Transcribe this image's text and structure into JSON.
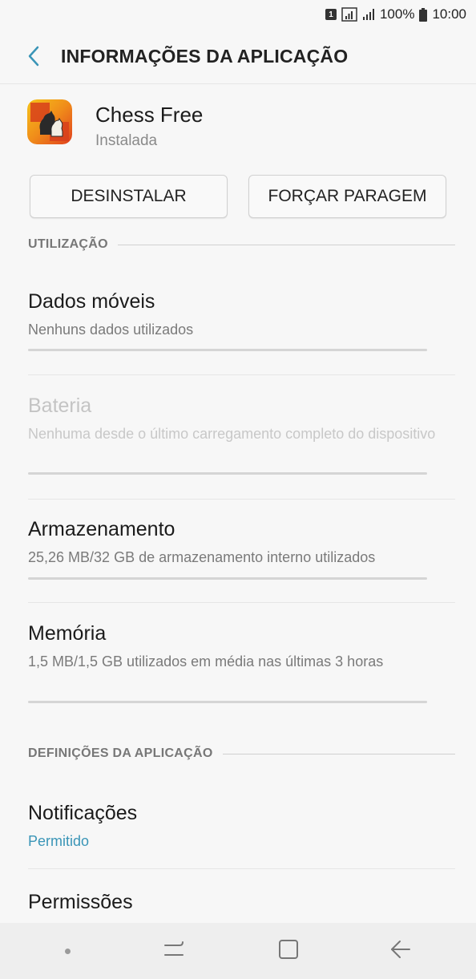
{
  "status_bar": {
    "sim_label": "1",
    "battery_percent": "100%",
    "time": "10:00"
  },
  "app_bar": {
    "title": "INFORMAÇÕES DA APLICAÇÃO"
  },
  "app": {
    "name": "Chess Free",
    "status": "Instalada"
  },
  "buttons": {
    "uninstall": "DESINSTALAR",
    "force_stop": "FORÇAR PARAGEM"
  },
  "sections": {
    "usage": "UTILIZAÇÃO",
    "app_settings": "DEFINIÇÕES DA APLICAÇÃO"
  },
  "items": {
    "mobile_data": {
      "title": "Dados móveis",
      "subtitle": "Nenhuns dados utilizados"
    },
    "battery": {
      "title": "Bateria",
      "subtitle": "Nenhuma desde o último carregamento completo do dispositivo"
    },
    "storage": {
      "title": "Armazenamento",
      "subtitle": "25,26 MB/32 GB de armazenamento interno utilizados"
    },
    "memory": {
      "title": "Memória",
      "subtitle": "1,5 MB/1,5 GB utilizados em média nas últimas 3 horas"
    },
    "notifications": {
      "title": "Notificações",
      "subtitle": "Permitido"
    },
    "permissions": {
      "title": "Permissões"
    }
  },
  "colors": {
    "accent": "#3a95b7",
    "background": "#f7f7f7"
  },
  "icons": [
    "sim-icon",
    "wifi-signal-icon",
    "signal-icon",
    "battery-icon",
    "back-arrow-icon",
    "chess-app-icon",
    "recent-apps-icon",
    "home-icon",
    "nav-back-icon"
  ]
}
